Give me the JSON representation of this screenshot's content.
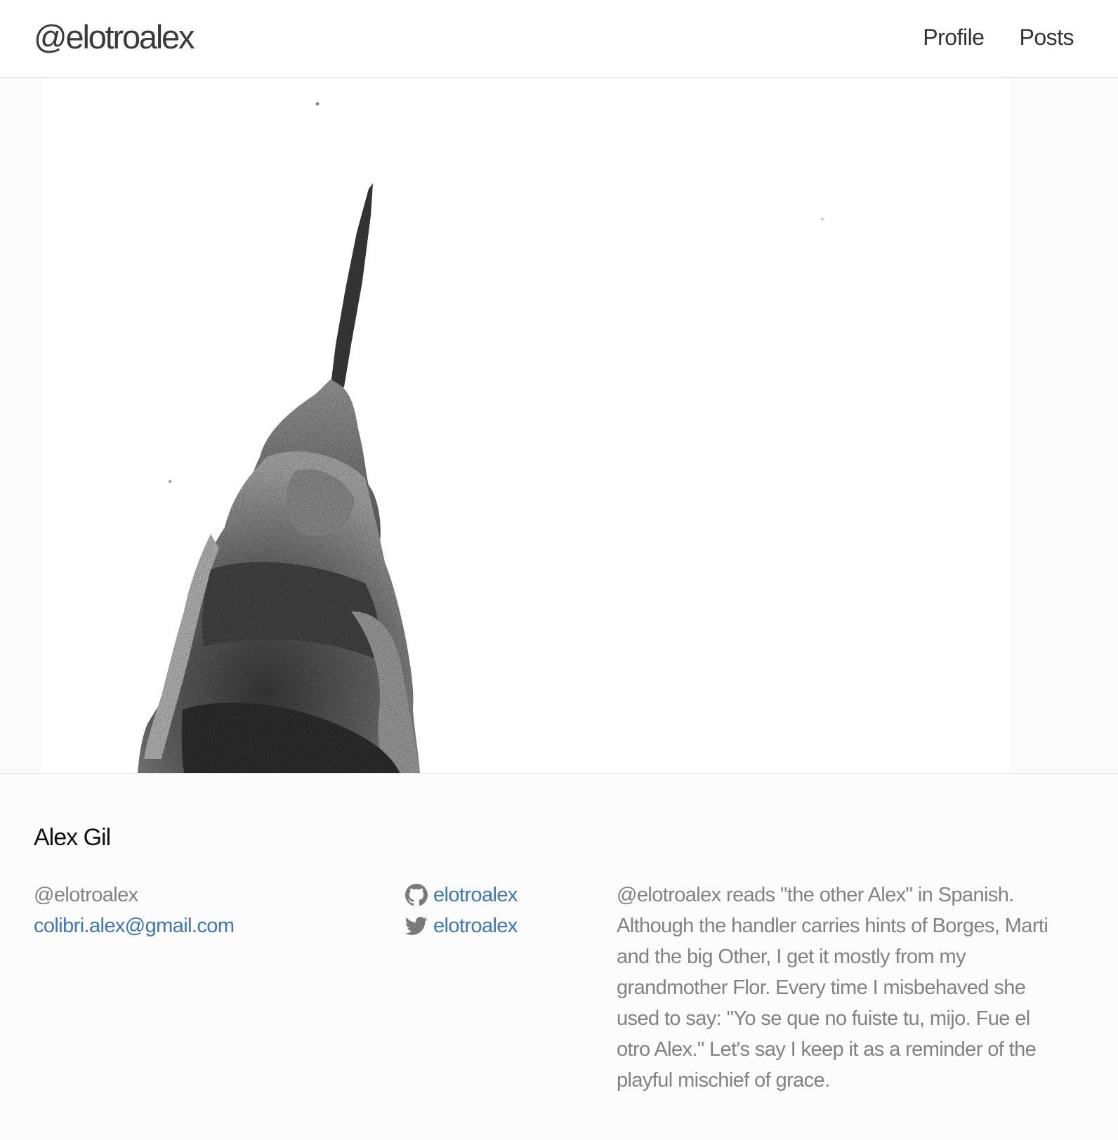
{
  "header": {
    "site_title": "@elotroalex",
    "nav": [
      {
        "label": "Profile"
      },
      {
        "label": "Posts"
      }
    ]
  },
  "hero": {
    "image_subject": "hummingbird-photo"
  },
  "profile": {
    "name": "Alex Gil",
    "handle": "@elotroalex",
    "email": "colibri.alex@gmail.com",
    "github": {
      "icon": "github-icon",
      "username": "elotroalex"
    },
    "twitter": {
      "icon": "twitter-icon",
      "username": "elotroalex"
    },
    "bio": "@elotroalex reads \"the other Alex\" in Spanish. Although the handler carries hints of Borges, Marti and the big Other, I get it mostly from my grandmother Flor. Every time I misbehaved she used to say: \"Yo se que no fuiste tu, mijo. Fue el otro Alex.\" Let's say I keep it as a reminder of the playful mischief of grace."
  },
  "colors": {
    "link": "#3a76c4",
    "muted_text": "#828282",
    "border": "#e3e3e3"
  }
}
